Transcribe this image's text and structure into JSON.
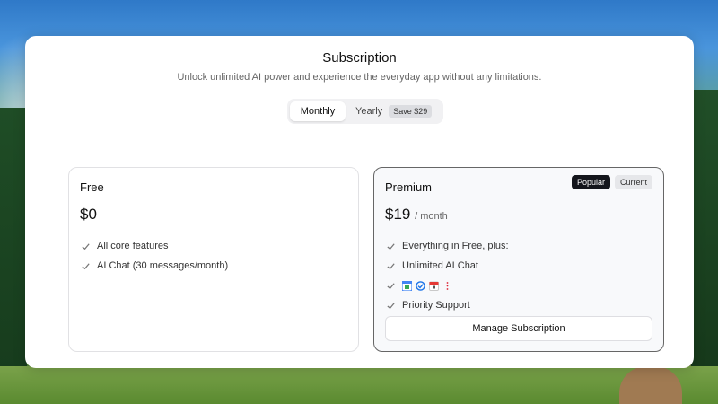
{
  "header": {
    "title": "Subscription",
    "subtitle": "Unlock unlimited AI power and experience the everyday app without any limitations."
  },
  "billing_toggle": {
    "monthly_label": "Monthly",
    "yearly_label": "Yearly",
    "save_badge": "Save $29",
    "selected": "Monthly"
  },
  "plans": {
    "free": {
      "name": "Free",
      "price": "$0",
      "features": [
        "All core features",
        "AI Chat (30 messages/month)"
      ]
    },
    "premium": {
      "name": "Premium",
      "price": "$19",
      "price_unit": "/ month",
      "badge_popular": "Popular",
      "badge_current": "Current",
      "features": [
        "Everything in Free, plus:",
        "Unlimited AI Chat"
      ],
      "integration_icons": [
        "google-calendar-icon",
        "task-check-icon",
        "calendar-icon",
        "more-vertical-icon"
      ],
      "feature_last": "Priority Support",
      "manage_button": "Manage Subscription"
    }
  },
  "colors": {
    "badge_dark": "#14161c",
    "panel": "#ffffff",
    "premium_border": "#666666"
  }
}
